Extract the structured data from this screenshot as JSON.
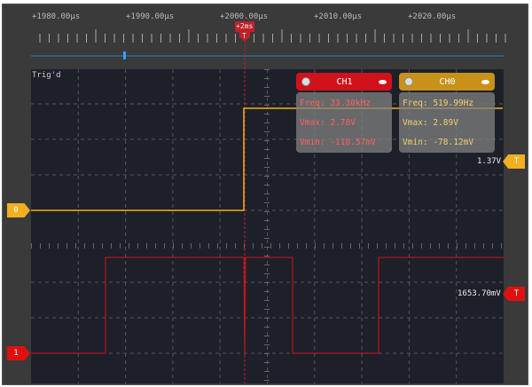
{
  "ruler": {
    "labels": [
      "+1980.00µs",
      "+1990.00µs",
      "+2000.00µs",
      "+2010.00µs",
      "+2020.00µs"
    ],
    "trigger_offset": "+2ms",
    "trigger_symbol": "T"
  },
  "status": "Trig'd",
  "channels": [
    {
      "name": "CH1",
      "color": "#d0121a",
      "text_color": "#ff6060",
      "freq": "Freq: 33.30kHz",
      "vmax": "Vmax: 2.78V",
      "vmin": "Vmin: -110.57mV",
      "marker": "1",
      "trigger_level": "1653.70mV",
      "trigger_symbol": "T"
    },
    {
      "name": "CH0",
      "color": "#c8921a",
      "text_color": "#f0d070",
      "freq": "Freq: 519.99Hz",
      "vmax": "Vmax: 2.89V",
      "vmin": "Vmin: -78.12mV",
      "marker": "0",
      "trigger_level": "1.37V",
      "trigger_symbol": "T"
    }
  ],
  "icons": {
    "settings": "gear-icon",
    "visibility": "eye-icon"
  }
}
